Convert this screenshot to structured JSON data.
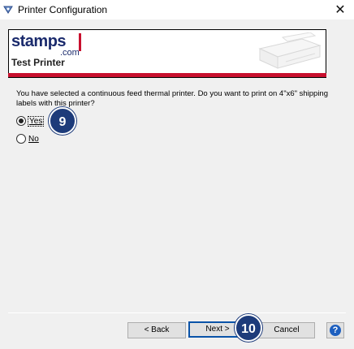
{
  "window": {
    "title": "Printer Configuration",
    "close_glyph": "✕",
    "icon": "printer-config-icon"
  },
  "banner": {
    "logo_text": "stamps",
    "logo_suffix": ".com",
    "printer_name": "Test Printer",
    "brand_color": "#c8102e"
  },
  "question": {
    "text": "You have selected a continuous feed thermal printer.  Do you want to print on 4\"x6\" shipping labels with this printer?"
  },
  "options": [
    {
      "label": "Yes",
      "checked": true
    },
    {
      "label": "No",
      "checked": false
    }
  ],
  "badges": {
    "step_a": "9",
    "step_b": "10",
    "color": "#1d3b7a"
  },
  "buttons": {
    "back": "< Back",
    "next": "Next >",
    "cancel": "Cancel",
    "help": "?"
  }
}
